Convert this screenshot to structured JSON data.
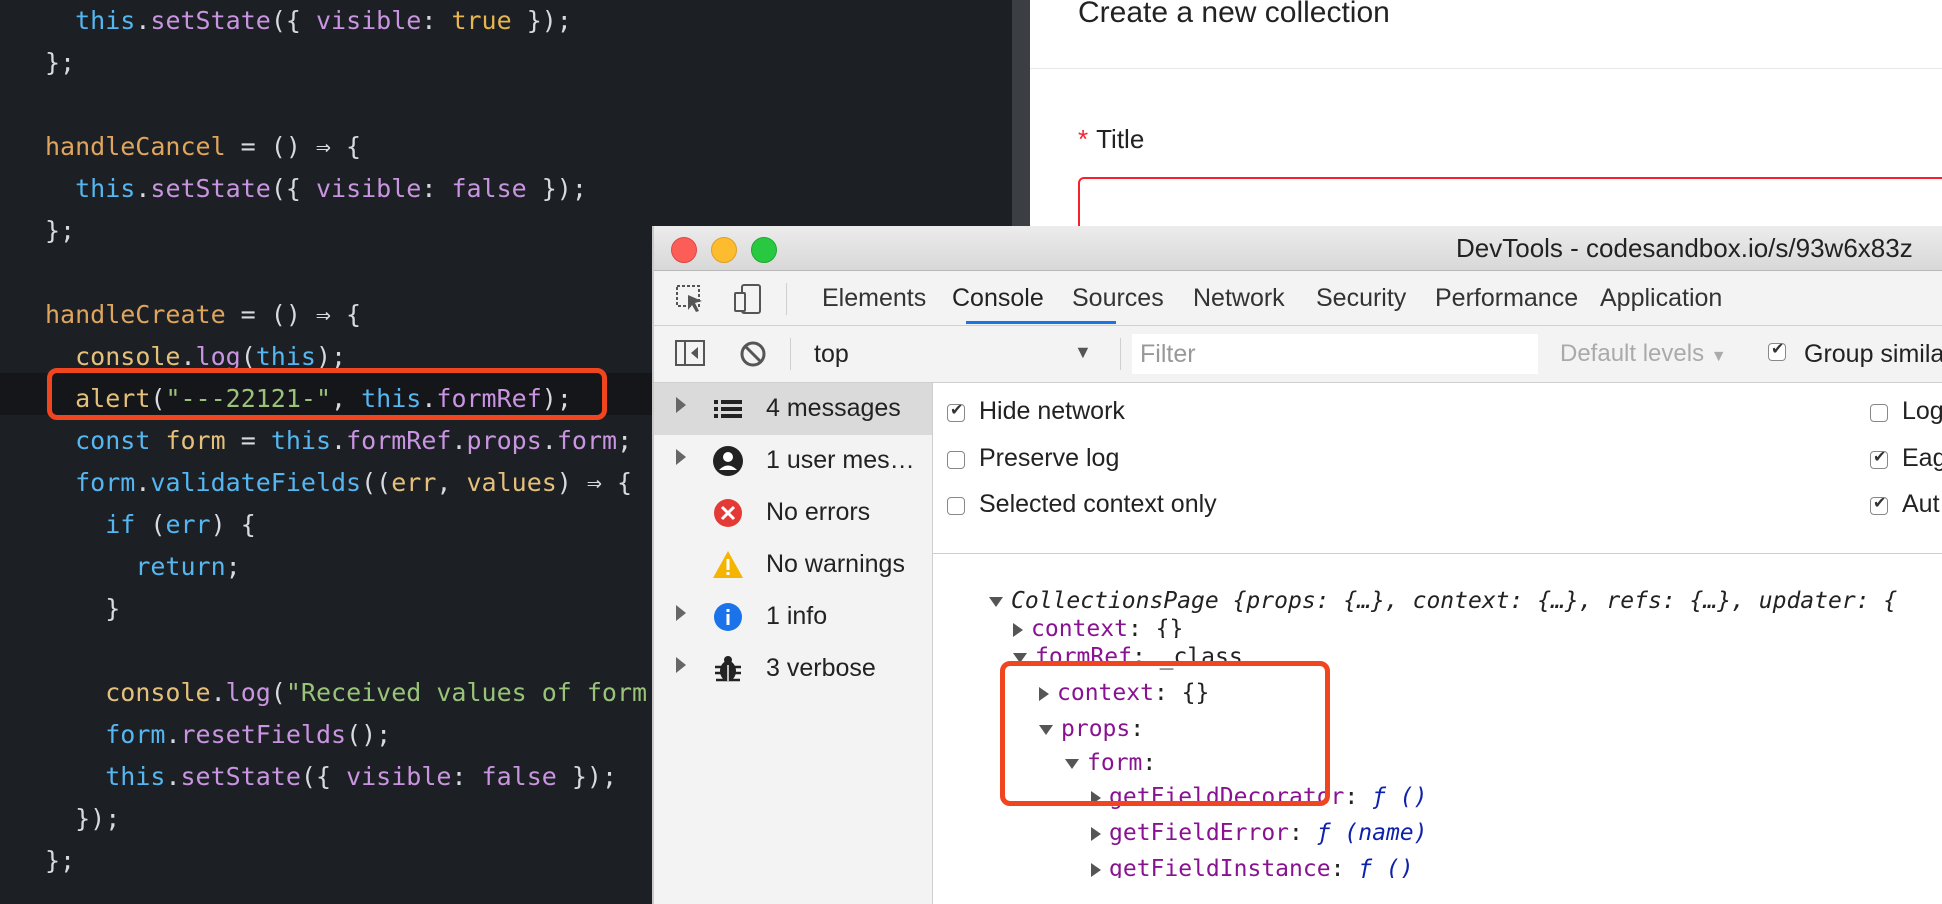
{
  "editor": {
    "lines": [
      "  this.setState({ visible: true });",
      "};",
      "",
      "handleCancel = () ⇒ {",
      "  this.setState({ visible: false });",
      "};",
      "",
      "handleCreate = () ⇒ {",
      "  console.log(this);",
      "  alert(\"---22121-\", this.formRef);",
      "  const form = this.formRef.props.form;",
      "  form.validateFields((err, values) ⇒ {",
      "    if (err) {",
      "      return;",
      "    }",
      "",
      "    console.log(\"Received values of form",
      "    form.resetFields();",
      "    this.setState({ visible: false });",
      "  });",
      "};"
    ],
    "highlight_color": "#f0451e"
  },
  "app": {
    "modal_title": "Create a new collection",
    "title_label": "Title",
    "required_mark": "*"
  },
  "devtools": {
    "window_title": "DevTools - codesandbox.io/s/93w6x83z",
    "tabs": [
      "Elements",
      "Console",
      "Sources",
      "Network",
      "Security",
      "Performance",
      "Application"
    ],
    "active_tab": "Console",
    "toolbar": {
      "context": "top",
      "filter_placeholder": "Filter",
      "levels": "Default levels",
      "group_similar": "Group simila"
    },
    "sidebar": [
      {
        "label": "4 messages",
        "icon": "list-icon"
      },
      {
        "label": "1 user mes…",
        "icon": "user-icon"
      },
      {
        "label": "No errors",
        "icon": "error-icon"
      },
      {
        "label": "No warnings",
        "icon": "warning-icon"
      },
      {
        "label": "1 info",
        "icon": "info-icon"
      },
      {
        "label": "3 verbose",
        "icon": "bug-icon"
      }
    ],
    "settings": {
      "left": [
        {
          "label": "Hide network",
          "checked": true
        },
        {
          "label": "Preserve log",
          "checked": false
        },
        {
          "label": "Selected context only",
          "checked": false
        }
      ],
      "right": [
        {
          "label": "Log",
          "checked": false
        },
        {
          "label": "Eag",
          "checked": true
        },
        {
          "label": "Aut",
          "checked": true
        }
      ]
    },
    "output": {
      "root_name": "CollectionsPage",
      "root_summary": "{props: {…}, context: {…}, refs: {…}, updater: {",
      "context_row": "context",
      "context_value": "{}",
      "formref_key": "formRef",
      "formref_value": "_class",
      "formref_context_key": "context",
      "formref_context_value": "{}",
      "props_key": "props",
      "form_key": "form",
      "methods": [
        {
          "key": "getFieldDecorator",
          "sig": "ƒ ()"
        },
        {
          "key": "getFieldError",
          "sig": "ƒ (name)"
        },
        {
          "key": "getFieldInstance",
          "sig": "ƒ ()"
        }
      ]
    }
  }
}
